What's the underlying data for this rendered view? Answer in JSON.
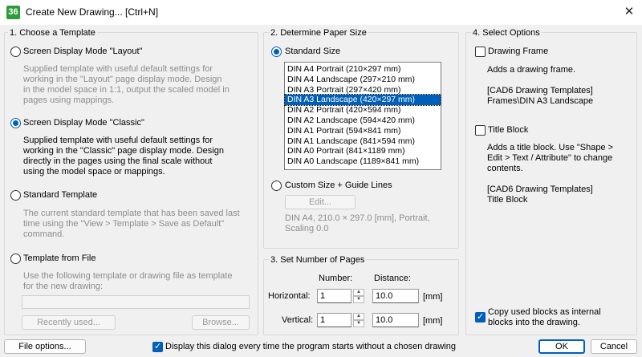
{
  "window": {
    "icon_text": "36",
    "title": "Create New Drawing... [Ctrl+N]",
    "close_glyph": "✕"
  },
  "template": {
    "legend": "1. Choose a Template",
    "layout": {
      "label": "Screen Display Mode \"Layout\"",
      "desc": "Supplied template with useful default settings for\nworking in the \"Layout\" page display mode. Design\nin the model space in 1:1, output the scaled model in\npages using mappings."
    },
    "classic": {
      "label": "Screen Display Mode \"Classic\"",
      "desc": "Supplied template with useful default settings for\nworking in the \"Classic\" page display mode. Design\ndirectly in the pages using the final scale without\nusing the model space or mappings."
    },
    "standard": {
      "label": "Standard Template",
      "desc": "The current standard template that has been saved last\ntime using the \"View > Template > Save as Default\"\ncommand."
    },
    "from_file": {
      "label": "Template from File",
      "desc": "Use the following template or drawing file as template\nfor the new drawing:",
      "path_value": ""
    },
    "recently_used": "Recently used...",
    "browse": "Browse..."
  },
  "paper": {
    "legend": "2. Determine Paper Size",
    "standard_label": "Standard Size",
    "sizes": [
      "DIN A4 Portrait (210×297 mm)",
      "DIN A4 Landscape (297×210 mm)",
      "DIN A3 Portrait (297×420 mm)",
      "DIN A3 Landscape (420×297 mm)",
      "DIN A2 Portrait (420×594 mm)",
      "DIN A2 Landscape (594×420 mm)",
      "DIN A1 Portrait (594×841 mm)",
      "DIN A1 Landscape (841×594 mm)",
      "DIN A0 Portrait (841×1189 mm)",
      "DIN A0 Landscape (1189×841 mm)"
    ],
    "selected_index": 3,
    "custom_label": "Custom Size + Guide Lines",
    "edit": "Edit...",
    "summary": "DIN A4, 210.0 × 297.0 [mm], Portrait,\nScaling 0.0"
  },
  "pages": {
    "legend": "3. Set Number of Pages",
    "number_header": "Number:",
    "distance_header": "Distance:",
    "horizontal_label": "Horizontal:",
    "vertical_label": "Vertical:",
    "h_number": "1",
    "h_distance": "10.0",
    "v_number": "1",
    "v_distance": "10.0",
    "unit": "[mm]"
  },
  "options": {
    "legend": "4. Select Options",
    "frame_label": "Drawing Frame",
    "frame_desc": "Adds a drawing frame.",
    "frame_path": "[CAD6 Drawing Templates]\nFrames\\DIN A3 Landscape",
    "title_label": "Title Block",
    "title_desc": "Adds a title block. Use \"Shape >\nEdit > Text / Attribute\" to change\ncontents.",
    "title_path": "[CAD6 Drawing Templates]\nTitle Block",
    "copy_label": "Copy used blocks as internal\nblocks into the drawing."
  },
  "footer": {
    "file_options": "File options...",
    "display_label": "Display this dialog every time the program starts without a chosen drawing",
    "ok": "OK",
    "cancel": "Cancel"
  },
  "colors": {
    "accent": "#005fb8",
    "disabled_text": "#8c8c8c",
    "app_icon": "#2e9b3a"
  }
}
